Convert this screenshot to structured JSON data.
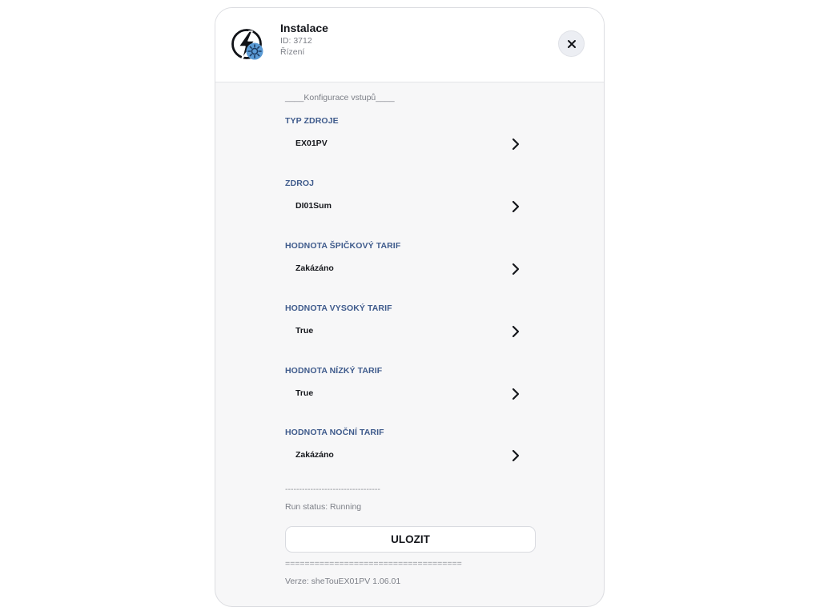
{
  "header": {
    "title": "Instalace",
    "id_text": "ID: 3712",
    "subtitle": "Řízení",
    "app_icon": "lightning-gear-icon",
    "close_icon": "close-icon"
  },
  "form": {
    "section_heading": "____Konfigurace vstupů____",
    "fields": [
      {
        "label": "TYP ZDROJE",
        "value": "EX01PV"
      },
      {
        "label": "ZDROJ",
        "value": "DI01Sum"
      },
      {
        "label": "HODNOTA ŠPIČKOVÝ TARIF",
        "value": "Zakázáno"
      },
      {
        "label": "HODNOTA VYSOKÝ TARIF",
        "value": "True"
      },
      {
        "label": "HODNOTA NÍZKÝ TARIF",
        "value": "True"
      },
      {
        "label": "HODNOTA NOČNÍ TARIF",
        "value": "Zakázáno"
      }
    ],
    "divider_dashes": "----------------------------------",
    "run_status": "Run status: Running",
    "save_label": "ULOZIT",
    "divider_equals": "====================================",
    "version": "Verze: sheTouEX01PV 1.06.01"
  },
  "colors": {
    "label_blue": "#3f5b8c",
    "text_dark": "#15171c",
    "muted_gray": "#7c7f87",
    "icon_blue": "#5b9bd5"
  }
}
